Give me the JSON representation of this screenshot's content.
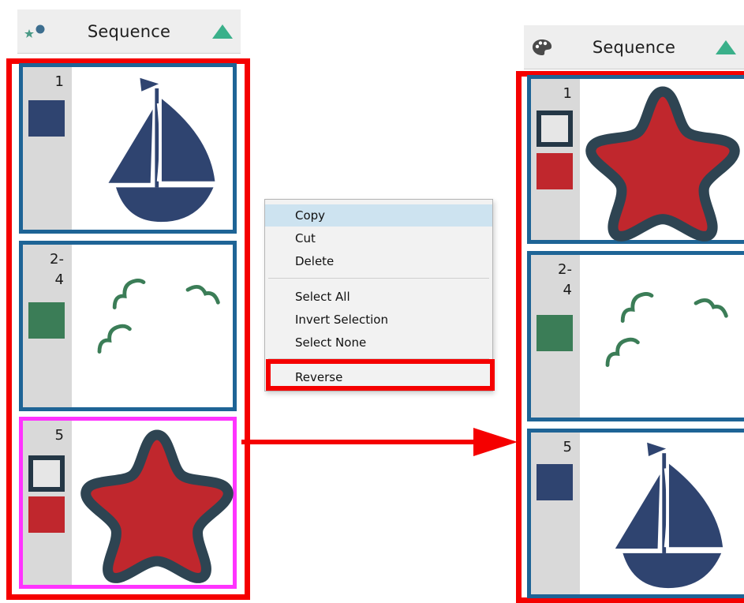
{
  "left_panel": {
    "title": "Sequence",
    "icon": "shapes-icon",
    "collapse_icon": "triangle-up-icon",
    "frames": [
      {
        "number": "1",
        "swatch": "filled",
        "swatch_color": "#2f4470",
        "art": "sailboat"
      },
      {
        "number": "2-\n4",
        "swatch": "filled",
        "swatch_color": "#3b7d57",
        "art": "birds"
      },
      {
        "number": "5",
        "swatch": "outline+filled",
        "swatch_color": "#c0272d",
        "art": "star",
        "selected": true
      }
    ]
  },
  "right_panel": {
    "title": "Sequence",
    "icon": "palette-icon",
    "collapse_icon": "triangle-up-icon",
    "frames": [
      {
        "number": "1",
        "swatch": "outline+filled",
        "swatch_color": "#c0272d",
        "art": "star"
      },
      {
        "number": "2-\n4",
        "swatch": "filled",
        "swatch_color": "#3b7d57",
        "art": "birds"
      },
      {
        "number": "5",
        "swatch": "filled",
        "swatch_color": "#2f4470",
        "art": "sailboat"
      }
    ]
  },
  "context_menu": {
    "items": [
      {
        "label": "Copy",
        "highlighted": true
      },
      {
        "label": "Cut"
      },
      {
        "label": "Delete"
      },
      {
        "label": "Select All"
      },
      {
        "label": "Invert Selection"
      },
      {
        "label": "Select None"
      },
      {
        "label": "Reverse",
        "emphasized": true
      }
    ]
  },
  "colors": {
    "frame_border": "#1e6496",
    "selection": "#ff33ff",
    "annotation": "#f50000",
    "accent_triangle": "#3ab08a",
    "navy": "#2f4470",
    "green": "#3b7d57",
    "red": "#c0272d"
  }
}
